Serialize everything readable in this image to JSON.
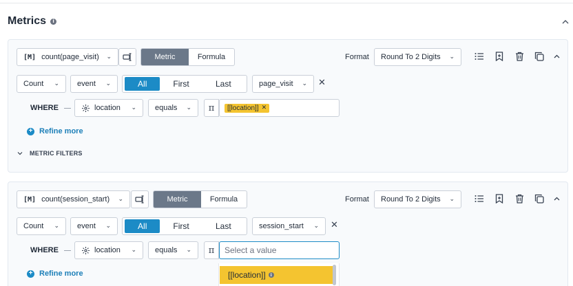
{
  "section": {
    "title": "Metrics",
    "info_icon": "info-icon",
    "collapse_icon": "chevron-up-icon"
  },
  "colors": {
    "accent_blue": "#1c8bc6",
    "toggle_active": "#6b7889",
    "chip_yellow": "#f4c430",
    "card_bg": "#f8fafc"
  },
  "metrics": [
    {
      "name": "count(page_visit)",
      "mode_options": [
        "Metric",
        "Formula"
      ],
      "mode_selected": "Metric",
      "format_label": "Format",
      "format_value": "Round To 2 Digits",
      "aggregation": "Count",
      "source": "event",
      "occurrence_options": [
        "All",
        "First",
        "Last"
      ],
      "occurrence_selected": "All",
      "event_name": "page_visit",
      "where_label": "WHERE",
      "filter_property": "location",
      "filter_operator": "equals",
      "filter_value_chip": "[[location]]",
      "refine_label": "Refine more",
      "metric_filters_label": "METRIC FILTERS",
      "actions": [
        "list-icon",
        "bookmark-add-icon",
        "trash-icon",
        "copy-icon",
        "chevron-up-icon"
      ]
    },
    {
      "name": "count(session_start)",
      "mode_options": [
        "Metric",
        "Formula"
      ],
      "mode_selected": "Metric",
      "format_label": "Format",
      "format_value": "Round To 2 Digits",
      "aggregation": "Count",
      "source": "event",
      "occurrence_options": [
        "All",
        "First",
        "Last"
      ],
      "occurrence_selected": "All",
      "event_name": "session_start",
      "where_label": "WHERE",
      "filter_property": "location",
      "filter_operator": "equals",
      "filter_value_placeholder": "Select a value",
      "refine_label": "Refine more",
      "dropdown_options": [
        "[[location]]"
      ],
      "actions": [
        "list-icon",
        "bookmark-add-icon",
        "trash-icon",
        "copy-icon",
        "chevron-up-icon"
      ]
    }
  ]
}
